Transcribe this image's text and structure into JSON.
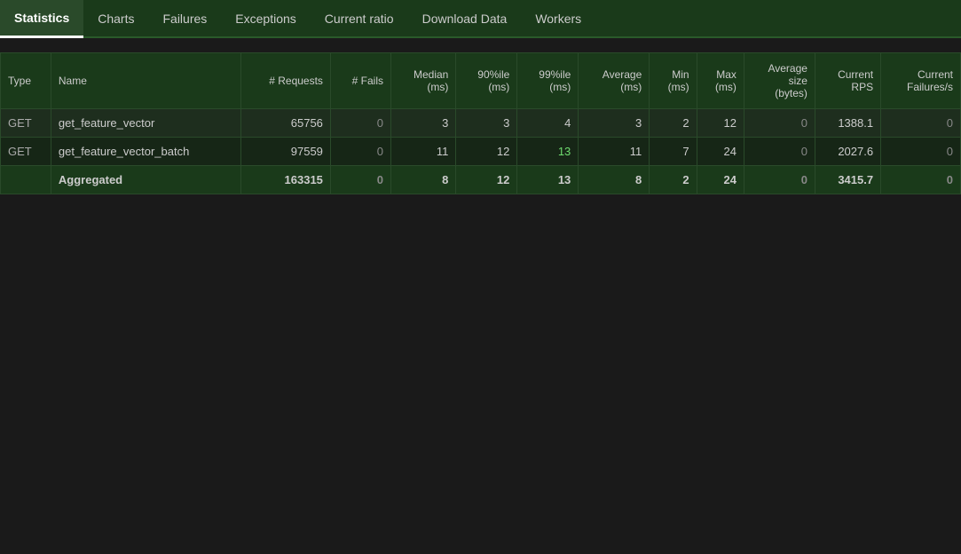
{
  "nav": {
    "items": [
      {
        "label": "Statistics",
        "active": true
      },
      {
        "label": "Charts",
        "active": false
      },
      {
        "label": "Failures",
        "active": false
      },
      {
        "label": "Exceptions",
        "active": false
      },
      {
        "label": "Current ratio",
        "active": false
      },
      {
        "label": "Download Data",
        "active": false
      },
      {
        "label": "Workers",
        "active": false
      }
    ]
  },
  "table": {
    "headers": [
      {
        "label": "Type"
      },
      {
        "label": "Name"
      },
      {
        "label": "# Requests"
      },
      {
        "label": "# Fails"
      },
      {
        "label": "Median\n(ms)"
      },
      {
        "label": "90%ile\n(ms)"
      },
      {
        "label": "99%ile\n(ms)"
      },
      {
        "label": "Average\n(ms)"
      },
      {
        "label": "Min\n(ms)"
      },
      {
        "label": "Max\n(ms)"
      },
      {
        "label": "Average\nsize\n(bytes)"
      },
      {
        "label": "Current\nRPS"
      },
      {
        "label": "Current\nFailures/s"
      }
    ],
    "rows": [
      {
        "type": "GET",
        "name": "get_feature_vector",
        "requests": "65756",
        "fails": "0",
        "median": "3",
        "p90": "3",
        "p99": "4",
        "average": "3",
        "min": "2",
        "max": "12",
        "avg_size": "0",
        "rps": "1388.1",
        "failures_s": "0"
      },
      {
        "type": "GET",
        "name": "get_feature_vector_batch",
        "requests": "97559",
        "fails": "0",
        "median": "11",
        "p90": "12",
        "p99": "13",
        "average": "11",
        "min": "7",
        "max": "24",
        "avg_size": "0",
        "rps": "2027.6",
        "failures_s": "0"
      }
    ],
    "aggregated": {
      "type": "",
      "name": "Aggregated",
      "requests": "163315",
      "fails": "0",
      "median": "8",
      "p90": "12",
      "p99": "13",
      "average": "8",
      "min": "2",
      "max": "24",
      "avg_size": "0",
      "rps": "3415.7",
      "failures_s": "0"
    }
  }
}
